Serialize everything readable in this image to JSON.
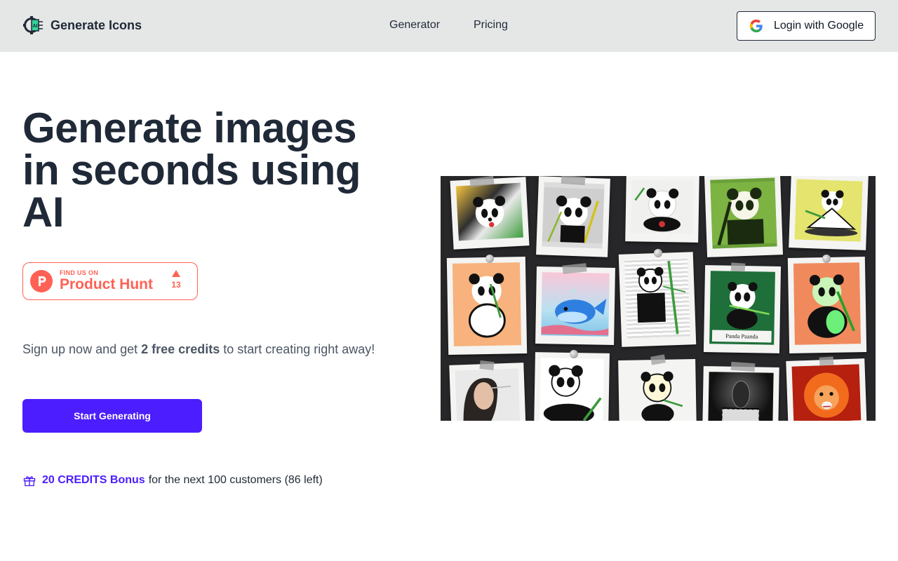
{
  "header": {
    "brand": "Generate Icons",
    "logo_icon": "ai-chip-logo-icon",
    "nav": [
      {
        "label": "Generator"
      },
      {
        "label": "Pricing"
      }
    ],
    "login_label": "Login with Google",
    "login_icon": "google-icon"
  },
  "hero": {
    "title": "Generate images in seconds using AI",
    "product_hunt": {
      "small": "FIND US ON",
      "big": "Product Hunt",
      "votes": "13"
    },
    "signup_pre": "Sign up now and get ",
    "signup_bold": "2 free credits",
    "signup_post": " to start creating right away!",
    "cta_label": "Start Generating",
    "bonus_highlight": "20 CREDITS Bonus",
    "bonus_rest": "for the next 100 customers (86 left)",
    "bonus_icon": "gift-icon"
  },
  "collage": {
    "caption": "Panda Paanda"
  },
  "colors": {
    "accent": "#4c1dfe",
    "product_hunt": "#ff6154",
    "header_bg": "#e5e7e6",
    "text": "#1f2937"
  }
}
